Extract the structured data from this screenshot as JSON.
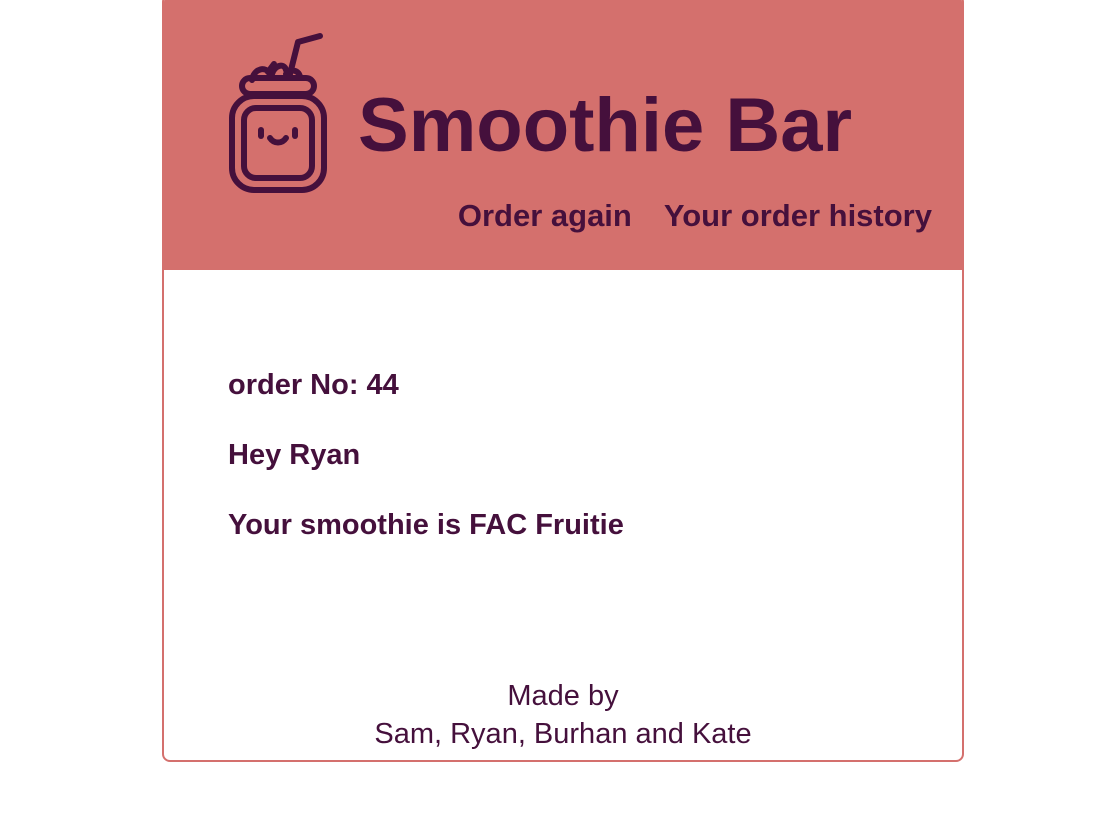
{
  "header": {
    "title": "Smoothie Bar",
    "logo_icon": "smoothie-jar-icon",
    "nav": [
      {
        "label": "Order again"
      },
      {
        "label": "Your order history"
      }
    ]
  },
  "order": {
    "number_line": "order No: 44",
    "greeting": "Hey Ryan",
    "smoothie_line": "Your smoothie is FAC Fruitie"
  },
  "footer": {
    "made_by": "Made by",
    "authors": "Sam, Ryan, Burhan and Kate"
  },
  "colors": {
    "header_bg": "#d4706d",
    "text": "#45103c",
    "card_border": "#d4706d",
    "page_bg": "#ffffff"
  }
}
